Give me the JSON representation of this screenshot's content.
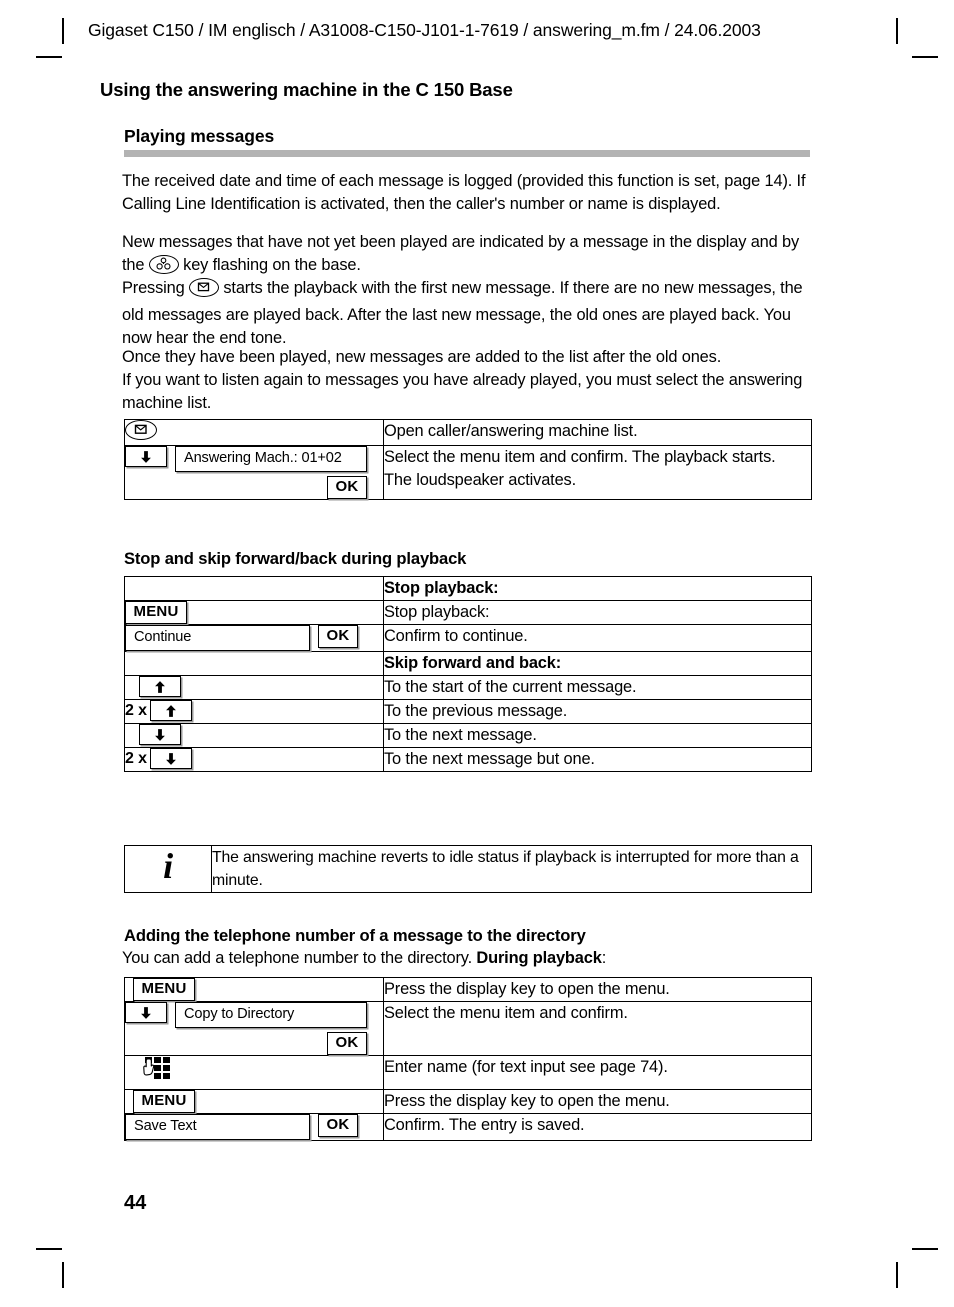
{
  "running_header": "Gigaset C150 / IM englisch / A31008-C150-J101-1-7619 / answering_m.fm / 24.06.2003",
  "chapter_title": "Using the answering machine in the C 150 Base",
  "section_title": "Playing messages",
  "paragraphs": {
    "p1_a": "The received date and time of each message is logged (provided this function is set, page 14). If Calling Line Identification is activated, then the caller's number or name  is displayed.",
    "p2_a": "New messages that have not yet been played are indicated by a message in the display and by the ",
    "p2_b": " key flashing on the base.",
    "p3_a": "Pressing ",
    "p3_b": " starts the playback with the first new message. If there are no new messages, the old messages are played back. After the last new message, the old ones are played back. You now hear the end tone.",
    "p4": "Once they have been played, new messages are added to the list after the old ones.",
    "p5": "If you want to listen again to messages you have already played, you must select the answering machine list."
  },
  "table_play": {
    "rows": [
      {
        "left_icon": "message-key-icon",
        "right_lines": [
          "Open caller/answering machine list."
        ]
      },
      {
        "nav_arrow": "down",
        "menu_field": "Answering Mach.:  01+02",
        "ok_label": "OK",
        "right_lines": [
          "Select the menu item and confirm. The playback starts.",
          "The loudspeaker activates."
        ]
      }
    ]
  },
  "sub_heading_stop": "Stop and skip forward/back during playback",
  "table_stop": {
    "rows": [
      {
        "left": null,
        "right": "Stop playback:",
        "bold": true
      },
      {
        "left_softkey": "MENU",
        "right": "Stop playback:",
        "bold": false
      },
      {
        "left_menu_field": "Continue",
        "left_ok": "OK",
        "right": "Confirm to continue.",
        "bold": false
      },
      {
        "left": null,
        "right": "Skip forward and back:",
        "bold": true
      },
      {
        "left_nav": "up",
        "right": "To the start of the current message.",
        "bold": false
      },
      {
        "left_prefix": "2 x",
        "left_nav": "up",
        "right": "To the previous message.",
        "bold": false
      },
      {
        "left_nav": "down",
        "right": "To the next message.",
        "bold": false
      },
      {
        "left_prefix": "2 x",
        "left_nav": "down",
        "right": "To the next message but one.",
        "bold": false
      }
    ]
  },
  "note": {
    "icon": "information-icon",
    "icon_glyph": "i",
    "text": "The answering machine reverts to idle status if playback is interrupted for more than a minute."
  },
  "sub_heading_directory": "Adding the telephone number of a message to the directory",
  "intro": {
    "plain": "You can add a telephone number to the directory. ",
    "bold": "During playback",
    "tail": ":"
  },
  "table_directory": {
    "rows": [
      {
        "left_softkey": "MENU",
        "right": "Press the display key to open the menu."
      },
      {
        "nav_arrow": "down",
        "menu_field": "Copy to Directory",
        "ok_label": "OK",
        "right": "Select the menu item and confirm."
      },
      {
        "keypad_icon": "keypad-entry-icon",
        "right": "Enter name (for text input see page 74)."
      },
      {
        "left_softkey": "MENU",
        "right": "Press the display key to open the menu."
      },
      {
        "left_menu_field": "Save Text",
        "left_ok": "OK",
        "right": "Confirm. The entry is saved."
      }
    ]
  },
  "page_number": "44",
  "colors": {
    "rule": "#b3b3b3",
    "text": "#000000",
    "shadow": "#9a9a9a"
  }
}
